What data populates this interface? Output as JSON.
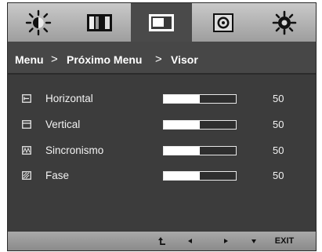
{
  "tabs": [
    {
      "name": "picture-brightness-icon"
    },
    {
      "name": "color-settings-icon"
    },
    {
      "name": "display-position-icon",
      "active": true
    },
    {
      "name": "audio-disc-icon"
    },
    {
      "name": "settings-gear-icon"
    }
  ],
  "breadcrumb": {
    "menu": "Menu",
    "sep1": ">",
    "next_menu": "Próximo Menu",
    "sep2": ">",
    "current": "Visor"
  },
  "rows": [
    {
      "label": "Horizontal",
      "value": "50",
      "level": 0.5,
      "icon": "horizontal-position-icon"
    },
    {
      "label": "Vertical",
      "value": "50",
      "level": 0.5,
      "icon": "vertical-position-icon"
    },
    {
      "label": "Sincronismo",
      "value": "50",
      "level": 0.5,
      "icon": "clock-sync-icon"
    },
    {
      "label": "Fase",
      "value": "50",
      "level": 0.5,
      "icon": "phase-icon"
    }
  ],
  "nav": {
    "back_icon": "return-icon",
    "left_icon": "left-arrow-icon",
    "right_icon": "right-arrow-icon",
    "down_icon": "down-arrow-icon",
    "exit_label": "EXIT"
  },
  "colors": {
    "tabbar": "#b4b4b4",
    "active_tab": "#4a4a4a",
    "panel": "#3c3c3c",
    "text": "#ffffff"
  }
}
